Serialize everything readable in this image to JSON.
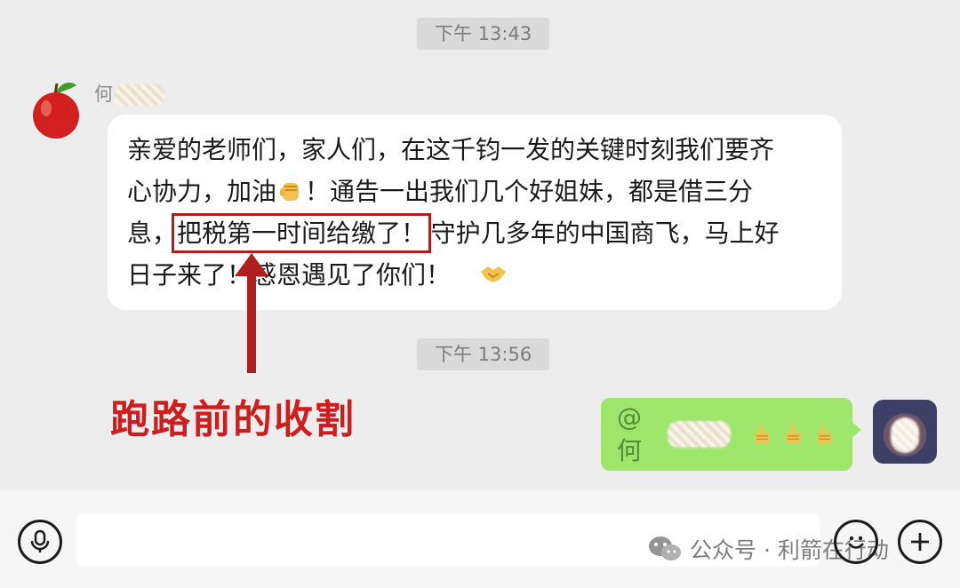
{
  "timestamps": [
    "下午 13:43",
    "下午 13:56"
  ],
  "left_message": {
    "sender_name": "何",
    "avatar_icon": "red-apple-icon",
    "lines": [
      {
        "text": "亲爱的老师们，家人们，在这千钧一发的关键时刻我们要齐"
      },
      {
        "before": "心协力，加油",
        "emoji": "raised-fist-icon",
        "after": "！通告一出我们几个好姐妹，都是借三分"
      },
      {
        "before": "息，",
        "highlight": "把税第一时间给缴了！",
        "after": "守护几多年的中国商飞，马上好"
      },
      {
        "before": "日子来了！感恩遇见了你们！",
        "emoji": "handshake-icon"
      }
    ]
  },
  "annotation": {
    "text": "跑路前的收割",
    "color": "#cf1d1d",
    "arrow_icon": "up-arrow-icon"
  },
  "right_message": {
    "mention": "@何",
    "thumbs_icon": "thumbs-up-icon",
    "thumbs_count": 3
  },
  "input_bar": {
    "voice_icon": "microphone-icon",
    "emoji_icon": "smiley-icon",
    "plus_icon": "plus-icon",
    "placeholder": ""
  },
  "watermark": {
    "text": "公众号 · 利箭在行动",
    "icon": "wechat-icon"
  },
  "colors": {
    "background": "#ededed",
    "bubble_self": "#9ee66b",
    "bubble_other": "#ffffff",
    "highlight_box": "#b01e1e"
  }
}
